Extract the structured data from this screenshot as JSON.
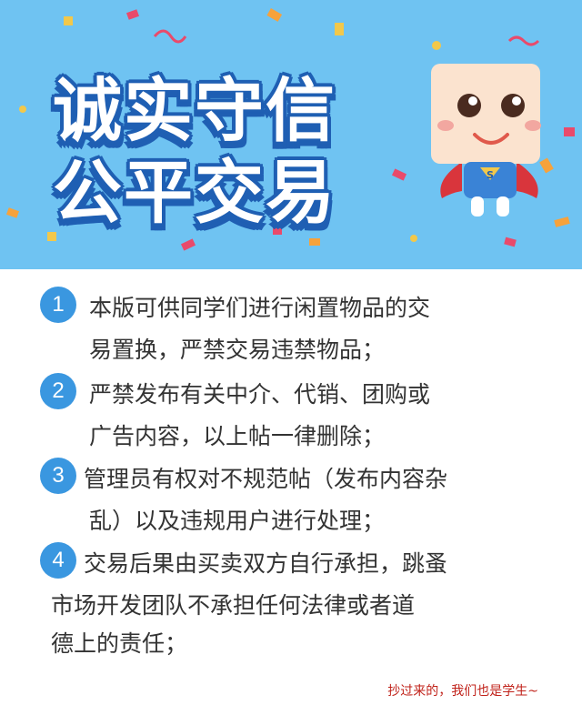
{
  "banner": {
    "title_line1": "诚实守信",
    "title_line2": "公平交易",
    "mascot_badge_letter": "S",
    "colors": {
      "sky": "#6fc3f2",
      "title_outline": "#1f5fb3",
      "title_fill": "#ffffff"
    }
  },
  "rules": [
    {
      "number": "1",
      "lines": [
        "本版可供同学们进行闲置物品的交",
        "易置换，严禁交易违禁物品；"
      ]
    },
    {
      "number": "2",
      "lines": [
        "严禁发布有关中介、代销、团购或",
        "广告内容，以上帖一律删除；"
      ]
    },
    {
      "number": "3",
      "lines": [
        "管理员有权对不规范帖（发布内容杂",
        "乱）以及违规用户进行处理；"
      ]
    },
    {
      "number": "4",
      "lines": [
        "交易后果由买卖双方自行承担，跳蚤",
        "市场开发团队不承担任何法律或者道",
        "德上的责任；"
      ]
    }
  ],
  "footer_note": "抄过来的，我们也是学生~",
  "colors": {
    "badge": "#3a97e0",
    "text": "#333333",
    "note": "#c0221a"
  }
}
